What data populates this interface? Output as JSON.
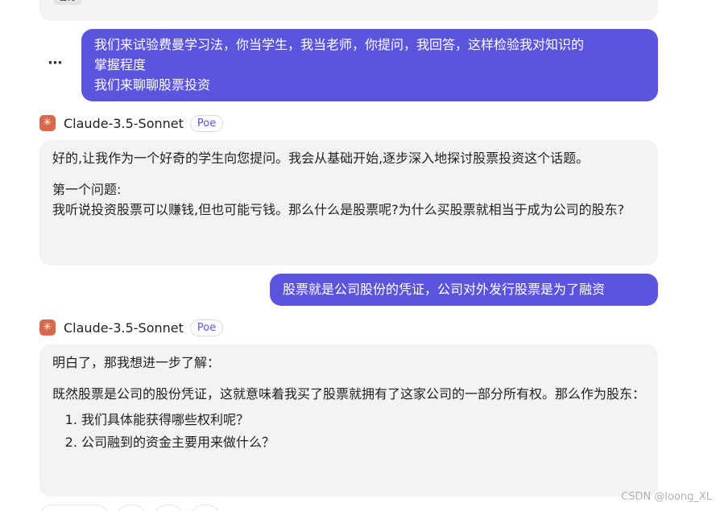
{
  "previous_message": {
    "chip_label": "官方"
  },
  "more_options_icon": "ellipsis-icon",
  "messages": [
    {
      "role": "user",
      "lines": [
        "我们来试验费曼学习法，你当学生，我当老师，你提问，我回答，这样检验我对知识的",
        "掌握程度",
        "我们来聊聊股票投资"
      ]
    },
    {
      "role": "bot",
      "bot_name": "Claude-3.5-Sonnet",
      "badge": "Poe",
      "avatar_icon": "claude-sparkle-icon",
      "paragraphs": [
        "好的,让我作为一个好奇的学生向您提问。我会从基础开始,逐步深入地探讨股票投资这个话题。",
        "第一个问题:",
        "我听说投资股票可以赚钱,但也可能亏钱。那么什么是股票呢?为什么买股票就相当于成为公司的股东?"
      ]
    },
    {
      "role": "user",
      "text": "股票就是公司股份的凭证，公司对外发行股票是为了融资"
    },
    {
      "role": "bot",
      "bot_name": "Claude-3.5-Sonnet",
      "badge": "Poe",
      "avatar_icon": "claude-sparkle-icon",
      "paragraphs": [
        "明白了，那我想进一步了解：",
        "既然股票是公司的股份凭证，这就意味着我买了股票就拥有了这家公司的一部分所有权。那么作为股东："
      ],
      "list": [
        "我们具体能获得哪些权利呢？",
        "公司融到的资金主要用来做什么？"
      ]
    }
  ],
  "watermark": "CSDN @loong_XL",
  "colors": {
    "user_bubble": "#5b54dd",
    "bot_bubble": "#f3f3f4",
    "avatar": "#d9684a",
    "badge_text": "#5b54dd"
  }
}
